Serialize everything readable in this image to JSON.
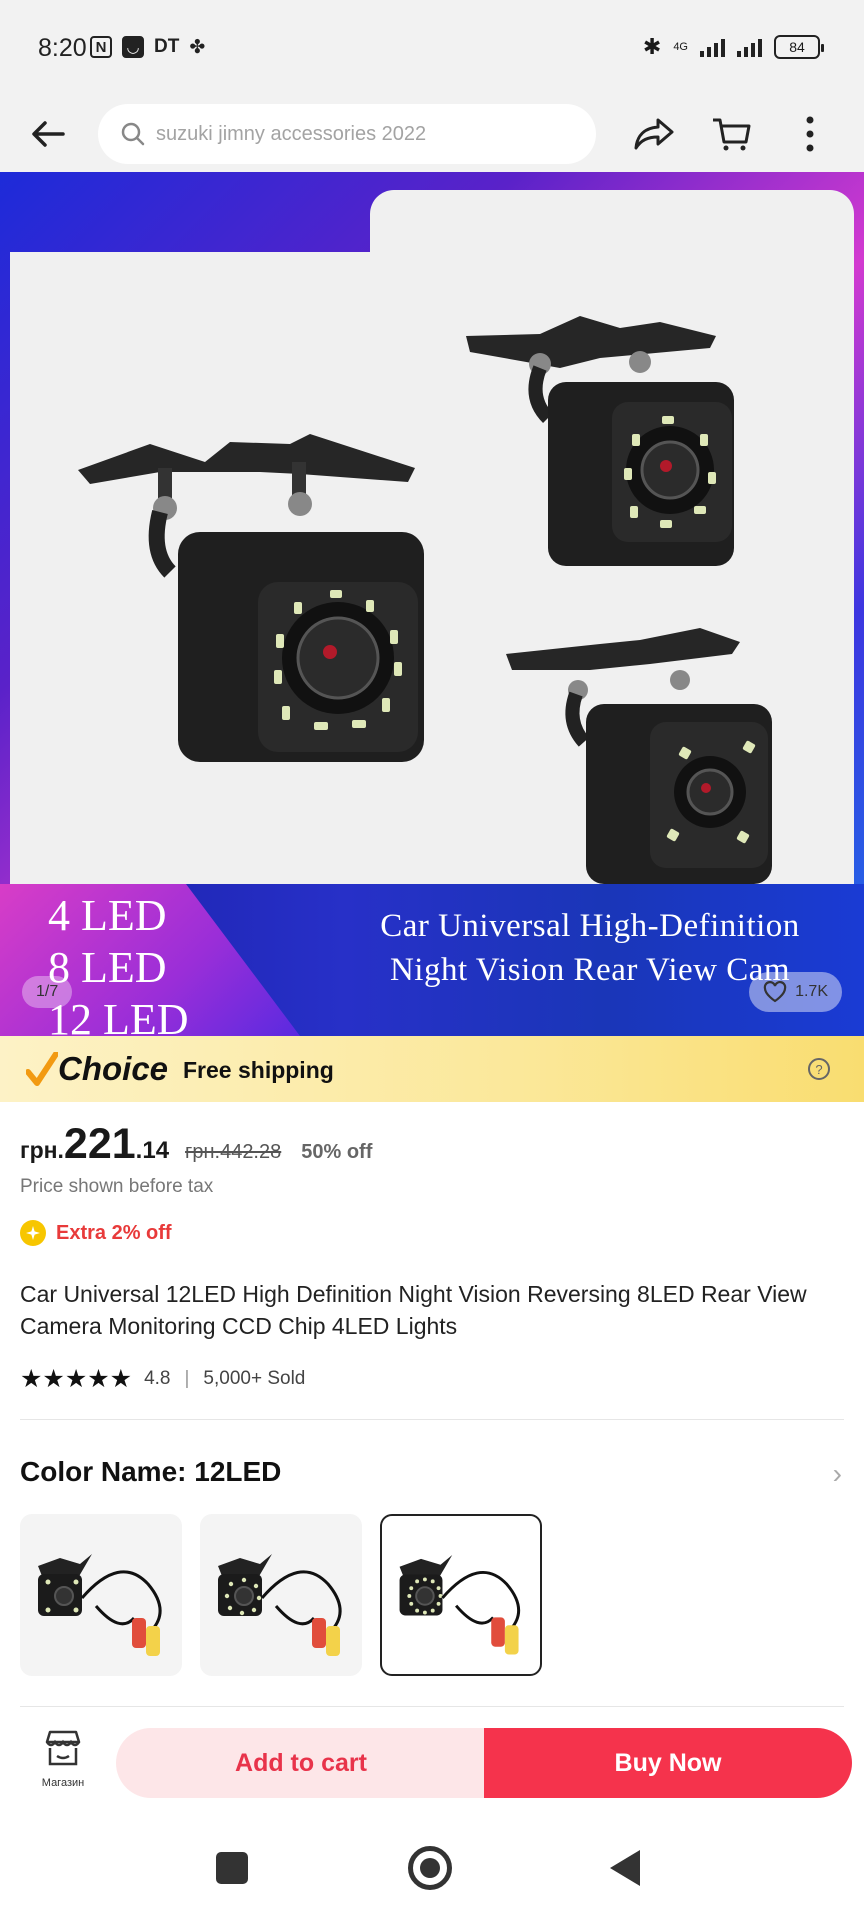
{
  "status_bar": {
    "time": "8:20",
    "left_icons": [
      "nfc-icon",
      "shopping-bag-icon",
      "dt-icon",
      "clover-icon"
    ],
    "dt_label": "DT",
    "network_label": "4G",
    "battery": "84"
  },
  "toolbar": {
    "search_placeholder": "suzuki jimny accessories 2022",
    "icons": [
      "back-arrow-icon",
      "search-icon",
      "share-icon",
      "cart-icon",
      "more-vertical-icon"
    ]
  },
  "hero": {
    "leds": [
      "4 LED",
      "8 LED",
      "12 LED"
    ],
    "caption_line1": "Car Universal High-Definition",
    "caption_line2": "Night Vision Rear View Cam",
    "pager": "1/7",
    "likes": "1.7K",
    "colors": {
      "accent": "#1d2bd9",
      "pink": "#d23ad0"
    }
  },
  "choice": {
    "brand": "Choice",
    "shipping": "Free shipping"
  },
  "price": {
    "currency": "грн.",
    "integer": "221",
    "decimal": ".14",
    "original": "грн.442.28",
    "discount": "50% off",
    "tax_note": "Price shown before tax",
    "extra": "Extra 2% off"
  },
  "product": {
    "title": "Car Universal 12LED High Definition Night Vision Reversing 8LED Rear View Camera Monitoring CCD Chip 4LED Lights",
    "stars": 5,
    "rating": "4.8",
    "separator": "|",
    "sold": "5,000+ Sold"
  },
  "variant": {
    "label": "Color Name: 12LED",
    "options": [
      "4LED",
      "8LED",
      "12LED"
    ],
    "selected_index": 2
  },
  "actions": {
    "store_label": "Магазин",
    "add_to_cart": "Add to cart",
    "buy_now": "Buy Now",
    "colors": {
      "cart_bg": "#fde6e8",
      "buy_bg": "#f5334c"
    }
  }
}
